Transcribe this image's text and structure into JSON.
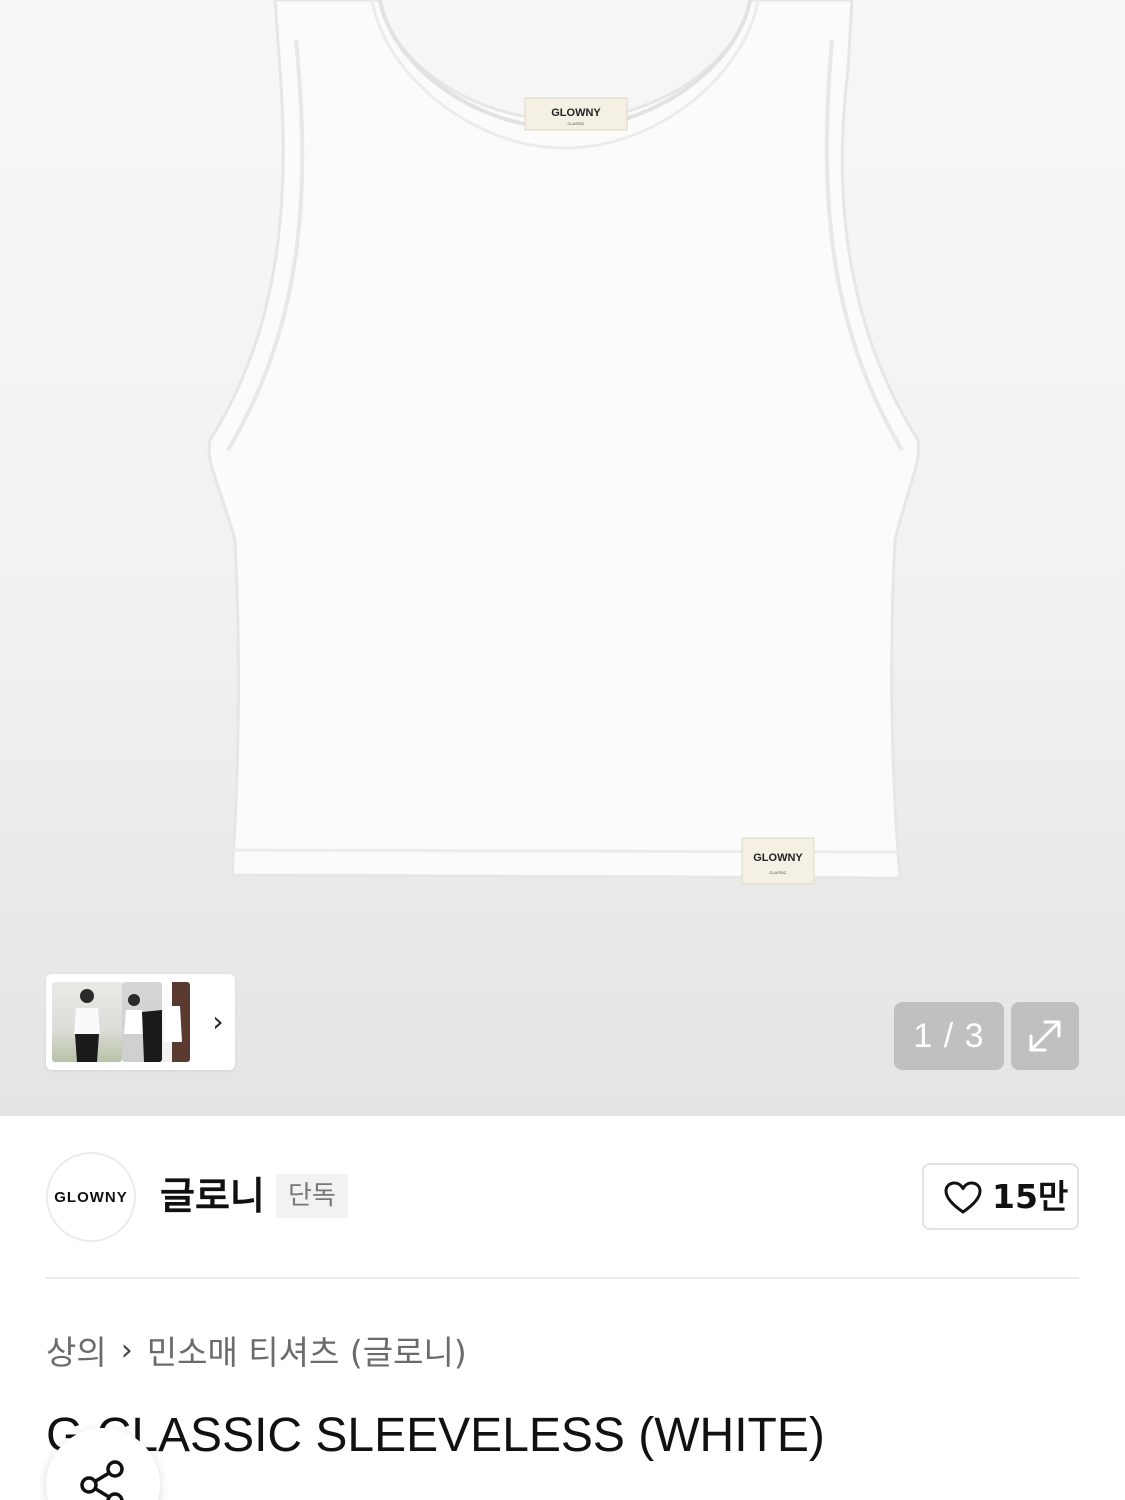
{
  "gallery": {
    "counter": "1 / 3",
    "current": 1,
    "total": 3,
    "garment_label_text": "GLOWNY",
    "garment_label_sub": "CLASSIC",
    "expand_icon": "expand-icon",
    "thumbnail_more_icon": "chevron-right-icon"
  },
  "brand": {
    "logo_text": "GLOWNY",
    "name": "글로니",
    "badge": "단독",
    "like_icon": "heart-icon",
    "like_count": "15만"
  },
  "breadcrumb": {
    "category": "상의",
    "separator_icon": "chevron-right-icon",
    "separator": "›",
    "subcategory": "민소매 티셔츠 (글로니)"
  },
  "product": {
    "title": "G CLASSIC SLEEVELESS (WHITE)"
  },
  "share": {
    "icon": "share-icon"
  },
  "colors": {
    "badge_bg": "#f2f2f2",
    "counter_bg": "#a0a0a0",
    "text_primary": "#111111",
    "text_secondary": "#6b6b6b"
  }
}
